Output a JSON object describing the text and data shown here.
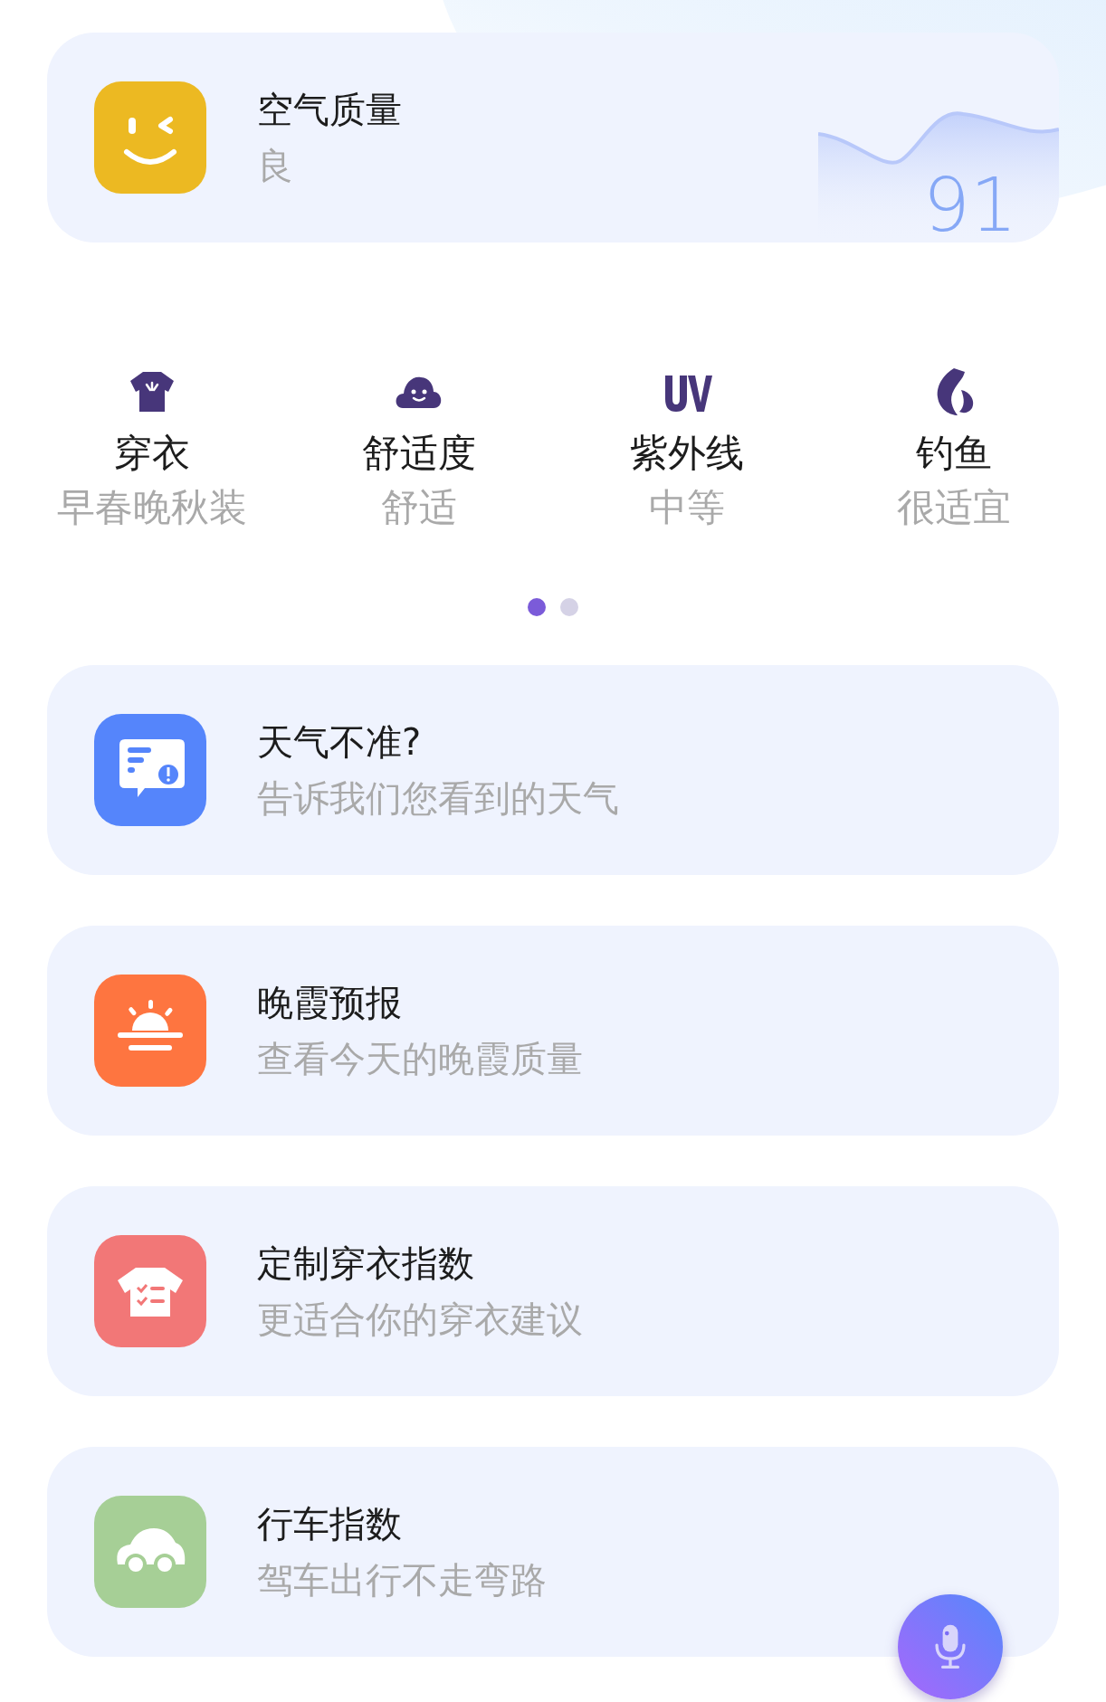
{
  "air_quality": {
    "title": "空气质量",
    "level_text": "良",
    "value": "91"
  },
  "indices": [
    {
      "kind": "clothing",
      "title": "穿衣",
      "value": "早春晚秋装"
    },
    {
      "kind": "comfort",
      "title": "舒适度",
      "value": "舒适"
    },
    {
      "kind": "uv",
      "title": "紫外线",
      "value": "中等"
    },
    {
      "kind": "fishing",
      "title": "钓鱼",
      "value": "很适宜"
    }
  ],
  "pager": [
    {
      "selected": true
    },
    {
      "selected": false
    }
  ],
  "features": [
    {
      "kind": "feedback",
      "title": "天气不准?",
      "subtitle": "告诉我们您看到的天气"
    },
    {
      "kind": "sunset",
      "title": "晚霞预报",
      "subtitle": "查看今天的晚霞质量"
    },
    {
      "kind": "custom_clothing",
      "title": "定制穿衣指数",
      "subtitle": "更适合你的穿衣建议"
    },
    {
      "kind": "driving",
      "title": "行车指数",
      "subtitle": "驾车出行不走弯路"
    }
  ]
}
